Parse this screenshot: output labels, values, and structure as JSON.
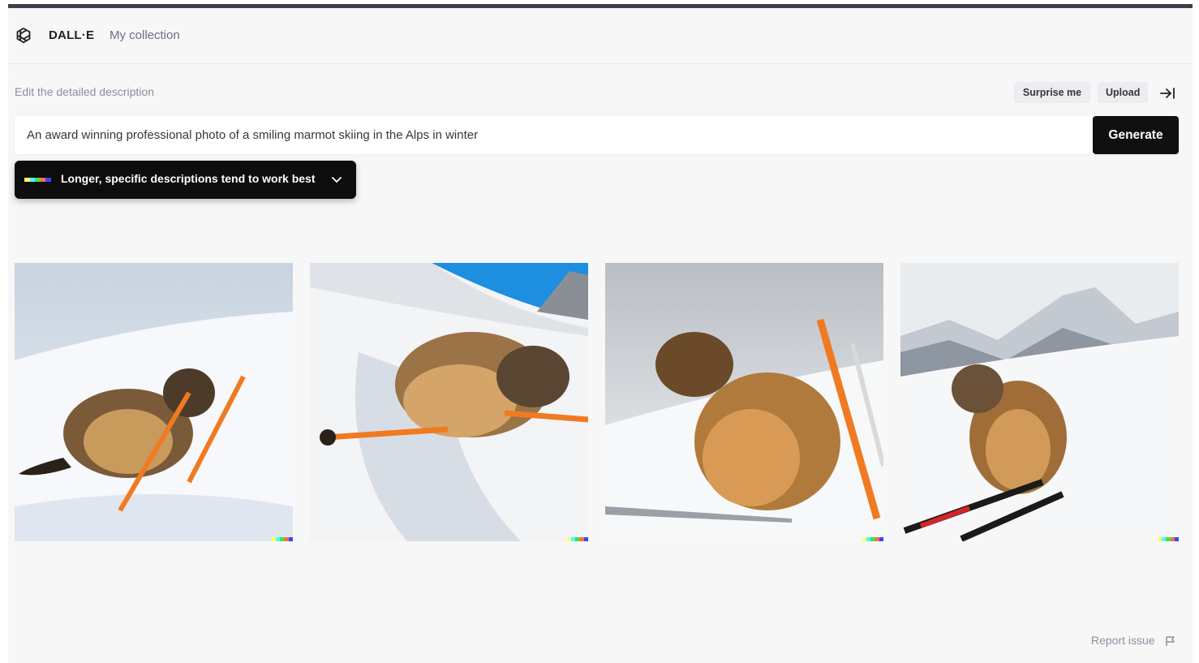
{
  "header": {
    "brand": "DALL·E",
    "nav_link": "My collection"
  },
  "prompt": {
    "label": "Edit the detailed description",
    "value": "An award winning professional photo of a smiling marmot skiing in the Alps in winter",
    "surprise_label": "Surprise me",
    "upload_label": "Upload",
    "generate_label": "Generate",
    "tip_text": "Longer, specific descriptions tend to work best"
  },
  "signature_colors": [
    "#ffff66",
    "#42ffff",
    "#51da4c",
    "#ff6e3c",
    "#3c46ff"
  ],
  "results": [
    {
      "alt": "marmot skiing image 1"
    },
    {
      "alt": "marmot skiing image 2"
    },
    {
      "alt": "marmot skiing image 3"
    },
    {
      "alt": "marmot skiing image 4"
    }
  ],
  "footer": {
    "report_label": "Report issue"
  },
  "icons": {
    "logo": "openai-logo-icon",
    "collapse": "arrow-right-to-bar-icon",
    "chevron": "chevron-down-icon",
    "flag": "flag-icon"
  }
}
